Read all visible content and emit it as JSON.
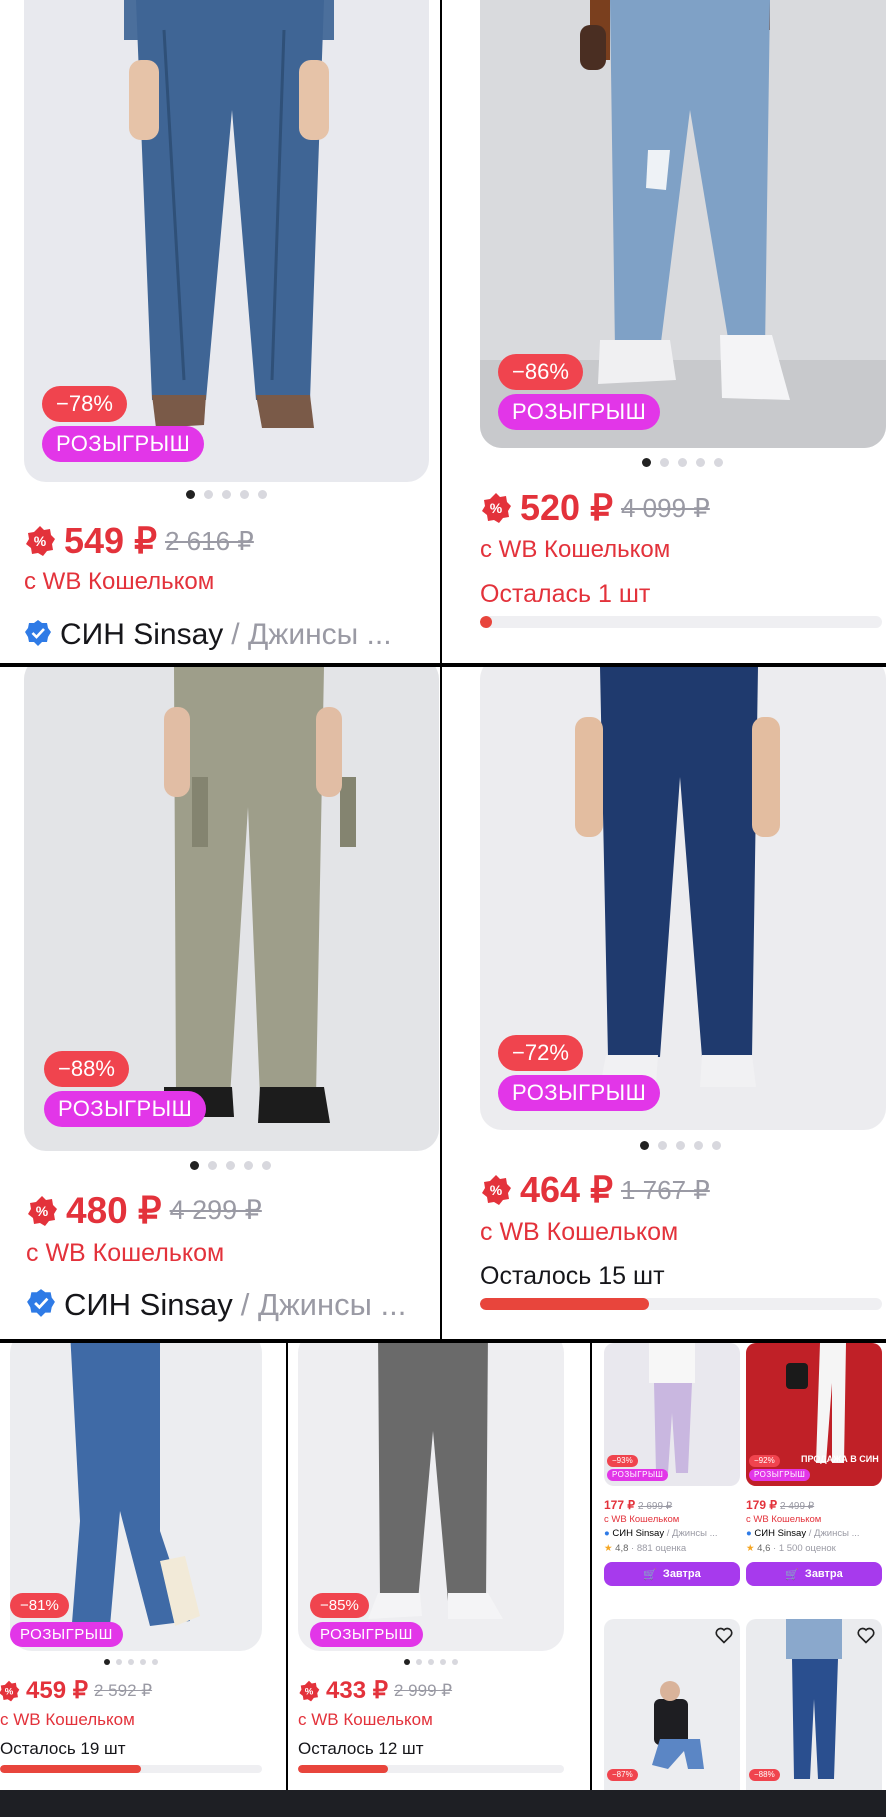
{
  "colors": {
    "accent_red": "#e3323b",
    "raffle_pink": "#e236e8",
    "button_purple": "#a73aed"
  },
  "products": [
    {
      "discount": "−78%",
      "promo": "РОЗЫГРЫШ",
      "price": "549 ₽",
      "old_price": "2 616 ₽",
      "wallet": "с WB Кошельком",
      "brand": "СИН Sinsay",
      "category": "/ Джинсы ..."
    },
    {
      "discount": "−86%",
      "promo": "РОЗЫГРЫШ",
      "price": "520 ₽",
      "old_price": "4 099 ₽",
      "wallet": "с WB Кошельком",
      "stock": "Осталась 1 шт",
      "stock_level": 0.02
    },
    {
      "discount": "−88%",
      "promo": "РОЗЫГРЫШ",
      "price": "480 ₽",
      "old_price": "4 299 ₽",
      "wallet": "с WB Кошельком",
      "brand": "СИН Sinsay",
      "category": "/ Джинсы ..."
    },
    {
      "discount": "−72%",
      "promo": "РОЗЫГРЫШ",
      "price": "464 ₽",
      "old_price": "1 767 ₽",
      "wallet": "с WB Кошельком",
      "stock": "Осталось 15 шт",
      "stock_level": 0.42
    },
    {
      "discount": "−81%",
      "promo": "РОЗЫГРЫШ",
      "price": "459 ₽",
      "old_price": "2 592 ₽",
      "wallet": "с WB Кошельком",
      "stock": "Осталось 19 шт",
      "stock_level": 0.54
    },
    {
      "discount": "−85%",
      "promo": "РОЗЫГРЫШ",
      "price": "433 ₽",
      "old_price": "2 999 ₽",
      "wallet": "с WB Кошельком",
      "stock": "Осталось 12 шт",
      "stock_level": 0.34
    }
  ],
  "mini": [
    {
      "discount": "−93%",
      "promo": "РОЗЫГРЫШ",
      "price": "177 ₽",
      "old_price": "2 699 ₽",
      "wallet": "с WB Кошельком",
      "brand": "СИН Sinsay",
      "category": "/ Джинсы ...",
      "rating": "4,8",
      "reviews": "· 881 оценка",
      "button": "Завтра"
    },
    {
      "discount": "−92%",
      "promo": "РОЗЫГРЫШ",
      "banner": "ПРОДАЖА В СИН",
      "price": "179 ₽",
      "old_price": "2 499 ₽",
      "wallet": "с WB Кошельком",
      "brand": "СИН Sinsay",
      "category": "/ Джинсы ...",
      "rating": "4,6",
      "reviews": "· 1 500 оценок",
      "button": "Завтра"
    },
    {
      "discount": "−87%"
    },
    {
      "discount": "−88%"
    }
  ]
}
